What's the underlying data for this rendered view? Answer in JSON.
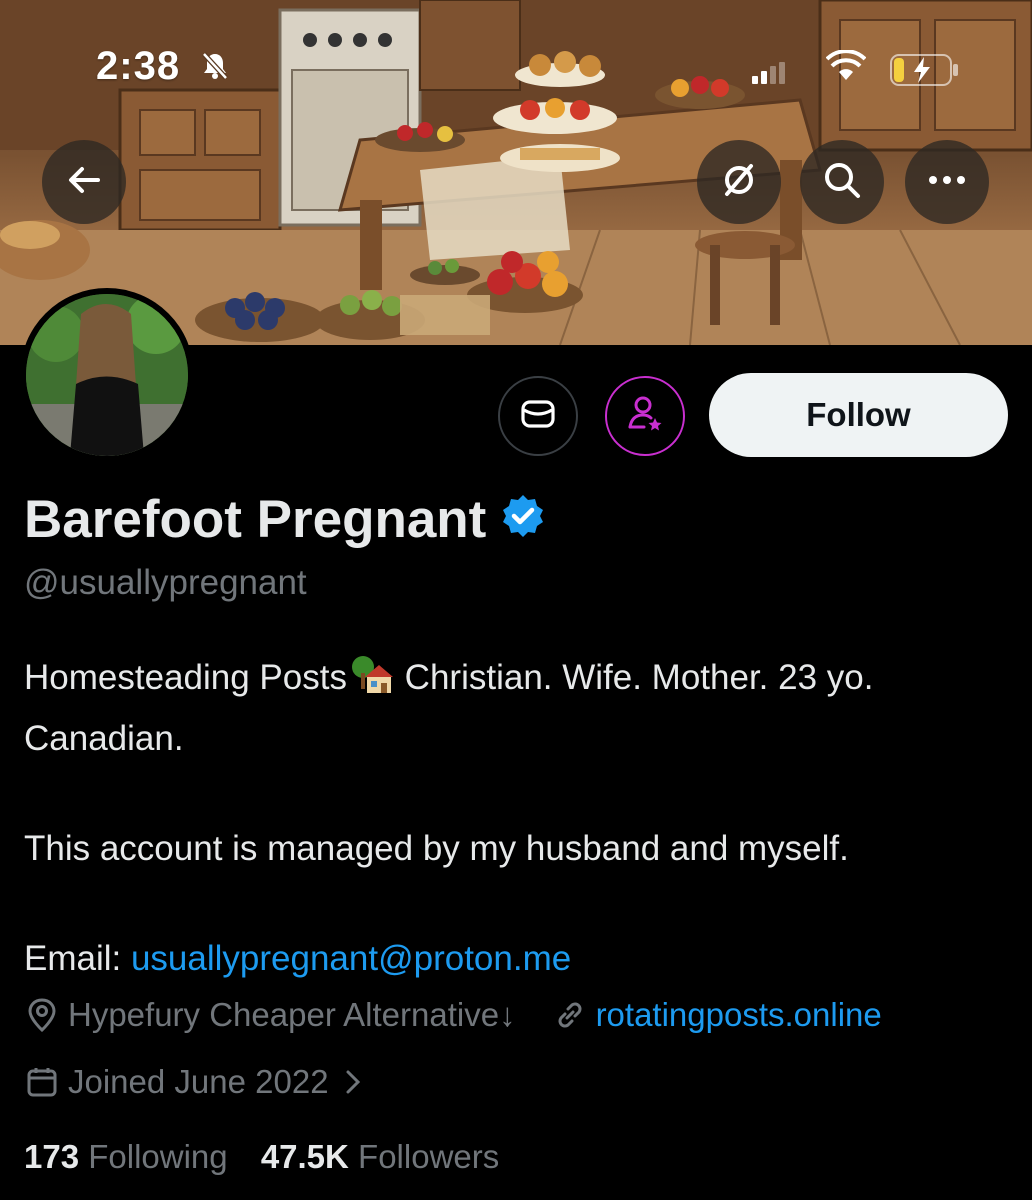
{
  "status_bar": {
    "time": "2:38"
  },
  "icons": {
    "back": "arrow-left-icon",
    "hide": "eye-slash-icon",
    "search": "search-icon",
    "more": "more-dots-icon",
    "message": "envelope-icon",
    "subscribe": "person-star-icon",
    "location": "location-pin-icon",
    "link": "link-icon",
    "calendar": "calendar-icon",
    "verified": "verified-badge-icon"
  },
  "profile": {
    "display_name": "Barefoot Pregnant",
    "handle": "@usuallypregnant",
    "follow_label": "Follow",
    "bio_line1_a": "Homesteading Posts",
    "bio_line1_b": " Christian. Wife. Mother. 23 yo.",
    "bio_line2": "Canadian.",
    "bio_line3": "This account is managed by my husband and myself.",
    "email_label": "Email: ",
    "email": "usuallypregnant@proton.me",
    "location": "Hypefury Cheaper Alternative↓",
    "website": "rotatingposts.online",
    "joined": "Joined June 2022",
    "following_count": "173",
    "following_label": "Following",
    "followers_count": "47.5K",
    "followers_label": "Followers"
  },
  "colors": {
    "accent_link": "#1d9bf0",
    "verified": "#1d9bf0",
    "subscribe_ring": "#c92fd0",
    "muted": "#71767b"
  }
}
